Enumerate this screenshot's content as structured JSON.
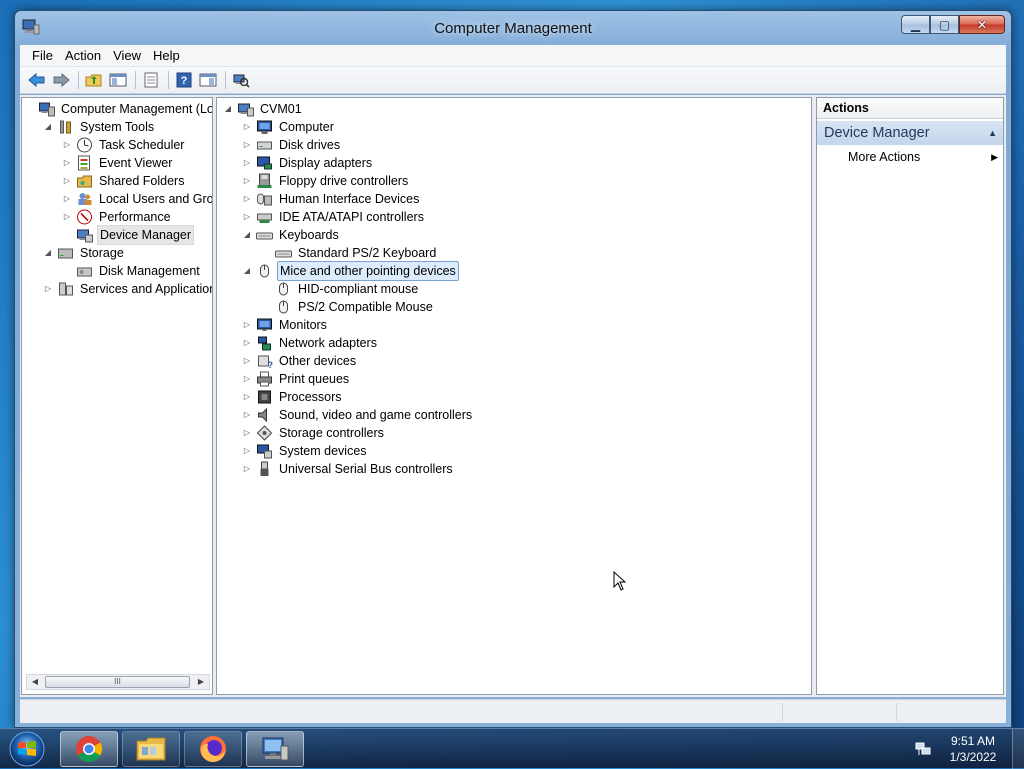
{
  "window": {
    "title": "Computer Management",
    "controls": {
      "minimize": "0",
      "maximize": "1",
      "close": "r"
    }
  },
  "menu": [
    "File",
    "Action",
    "View",
    "Help"
  ],
  "toolbar": [
    "back-icon",
    "forward-icon",
    "up-folder-icon",
    "show-hide-console-tree-icon",
    "properties-icon",
    "help-icon",
    "show-hide-action-pane-icon",
    "scan-hardware-icon"
  ],
  "left_tree": [
    {
      "label": "Computer Management (Local",
      "icon": "computer-management-icon",
      "twisty": "",
      "indent": 0
    },
    {
      "label": "System Tools",
      "icon": "system-tools-icon",
      "twisty": "expanded",
      "indent": 1
    },
    {
      "label": "Task Scheduler",
      "icon": "clock-icon",
      "twisty": "collapsed",
      "indent": 2
    },
    {
      "label": "Event Viewer",
      "icon": "event-viewer-icon",
      "twisty": "collapsed",
      "indent": 2
    },
    {
      "label": "Shared Folders",
      "icon": "shared-folders-icon",
      "twisty": "collapsed",
      "indent": 2
    },
    {
      "label": "Local Users and Groups",
      "icon": "users-icon",
      "twisty": "collapsed",
      "indent": 2
    },
    {
      "label": "Performance",
      "icon": "performance-icon",
      "twisty": "collapsed",
      "indent": 2
    },
    {
      "label": "Device Manager",
      "icon": "device-manager-icon",
      "twisty": "",
      "indent": 2,
      "selected": true
    },
    {
      "label": "Storage",
      "icon": "storage-icon",
      "twisty": "expanded",
      "indent": 1
    },
    {
      "label": "Disk Management",
      "icon": "disk-management-icon",
      "twisty": "",
      "indent": 2
    },
    {
      "label": "Services and Applications",
      "icon": "services-icon",
      "twisty": "collapsed",
      "indent": 1
    }
  ],
  "device_tree": [
    {
      "label": "CVM01",
      "icon": "computer-root-icon",
      "twisty": "expanded",
      "indent": 0
    },
    {
      "label": "Computer",
      "icon": "computer-icon",
      "twisty": "collapsed",
      "indent": 1
    },
    {
      "label": "Disk drives",
      "icon": "disk-drive-icon",
      "twisty": "collapsed",
      "indent": 1
    },
    {
      "label": "Display adapters",
      "icon": "display-adapter-icon",
      "twisty": "collapsed",
      "indent": 1
    },
    {
      "label": "Floppy drive controllers",
      "icon": "floppy-controller-icon",
      "twisty": "collapsed",
      "indent": 1
    },
    {
      "label": "Human Interface Devices",
      "icon": "hid-icon",
      "twisty": "collapsed",
      "indent": 1
    },
    {
      "label": "IDE ATA/ATAPI controllers",
      "icon": "ide-controller-icon",
      "twisty": "collapsed",
      "indent": 1
    },
    {
      "label": "Keyboards",
      "icon": "keyboard-icon",
      "twisty": "expanded",
      "indent": 1
    },
    {
      "label": "Standard PS/2 Keyboard",
      "icon": "keyboard-icon",
      "twisty": "",
      "indent": 2
    },
    {
      "label": "Mice and other pointing devices",
      "icon": "mouse-icon",
      "twisty": "expanded",
      "indent": 1,
      "selected": true
    },
    {
      "label": "HID-compliant mouse",
      "icon": "mouse-icon",
      "twisty": "",
      "indent": 2
    },
    {
      "label": "PS/2 Compatible Mouse",
      "icon": "mouse-icon",
      "twisty": "",
      "indent": 2
    },
    {
      "label": "Monitors",
      "icon": "monitor-icon",
      "twisty": "collapsed",
      "indent": 1
    },
    {
      "label": "Network adapters",
      "icon": "network-adapter-icon",
      "twisty": "collapsed",
      "indent": 1
    },
    {
      "label": "Other devices",
      "icon": "other-devices-icon",
      "twisty": "collapsed",
      "indent": 1
    },
    {
      "label": "Print queues",
      "icon": "printer-icon",
      "twisty": "collapsed",
      "indent": 1
    },
    {
      "label": "Processors",
      "icon": "processor-icon",
      "twisty": "collapsed",
      "indent": 1
    },
    {
      "label": "Sound, video and game controllers",
      "icon": "speaker-icon",
      "twisty": "collapsed",
      "indent": 1
    },
    {
      "label": "Storage controllers",
      "icon": "storage-controller-icon",
      "twisty": "collapsed",
      "indent": 1
    },
    {
      "label": "System devices",
      "icon": "system-devices-icon",
      "twisty": "collapsed",
      "indent": 1
    },
    {
      "label": "Universal Serial Bus controllers",
      "icon": "usb-icon",
      "twisty": "collapsed",
      "indent": 1
    }
  ],
  "actions": {
    "header": "Actions",
    "section": "Device Manager",
    "items": [
      "More Actions"
    ]
  },
  "scrollbar": {
    "thumb_grip": "III"
  },
  "taskbar": {
    "apps": [
      {
        "name": "chrome",
        "icon": "chrome-icon",
        "active": true
      },
      {
        "name": "explorer",
        "icon": "folder-icon",
        "active": false
      },
      {
        "name": "firefox",
        "icon": "firefox-icon",
        "active": false
      },
      {
        "name": "computer-management",
        "icon": "computer-management-taskbar-icon",
        "active": true
      }
    ],
    "clock_time": "9:51 AM",
    "clock_date": "1/3/2022"
  }
}
